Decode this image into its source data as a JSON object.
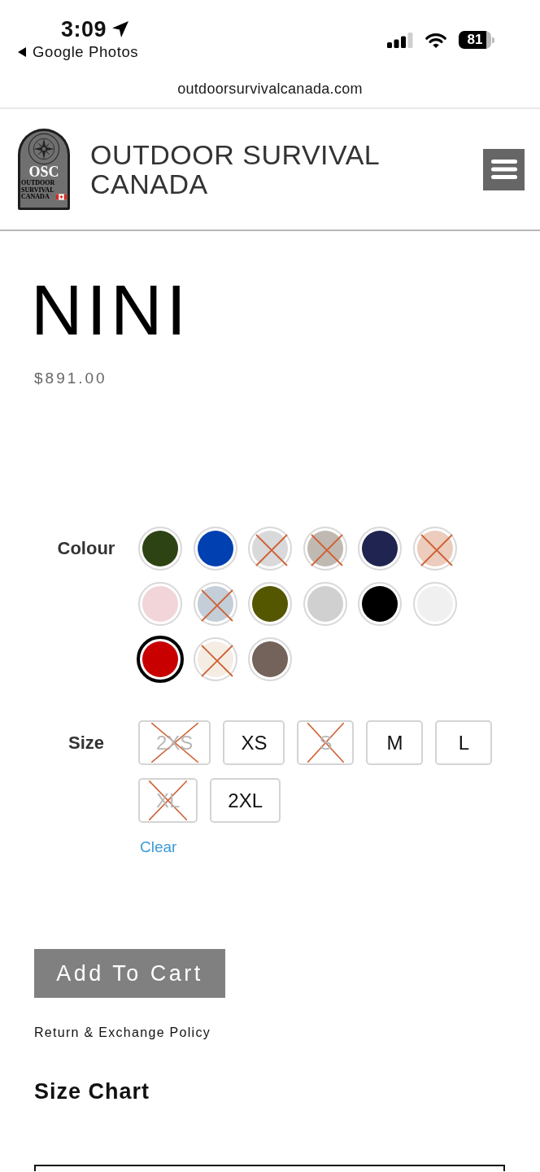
{
  "status_bar": {
    "time": "3:09",
    "back_label": "Google Photos",
    "battery": "81"
  },
  "address_bar": {
    "url": "outdoorsurvivalcanada.com"
  },
  "header": {
    "logo": {
      "monogram": "OSC",
      "tagline": "OUTDOOR SURVIVAL CANADA"
    },
    "site_title": "OUTDOOR SURVIVAL CANADA"
  },
  "product": {
    "name": "NINI",
    "price": "$891.00"
  },
  "colour": {
    "label": "Colour",
    "swatches": [
      {
        "color": "#2d4314",
        "available": true,
        "selected": false
      },
      {
        "color": "#0040b0",
        "available": true,
        "selected": false
      },
      {
        "color": "#d9d9dc",
        "available": false,
        "selected": false
      },
      {
        "color": "#c0b9b2",
        "available": false,
        "selected": false
      },
      {
        "color": "#1f2550",
        "available": true,
        "selected": false
      },
      {
        "color": "#ecccbc",
        "available": false,
        "selected": false
      },
      {
        "color": "#f2d5d8",
        "available": true,
        "selected": false
      },
      {
        "color": "#c3ced8",
        "available": false,
        "selected": false
      },
      {
        "color": "#545700",
        "available": true,
        "selected": false
      },
      {
        "color": "#d0d0d0",
        "available": true,
        "selected": false
      },
      {
        "color": "#000000",
        "available": true,
        "selected": false
      },
      {
        "color": "#f0f0f0",
        "available": true,
        "selected": false
      },
      {
        "color": "#c80000",
        "available": true,
        "selected": true
      },
      {
        "color": "#f5ede4",
        "available": false,
        "selected": false
      },
      {
        "color": "#74635a",
        "available": true,
        "selected": false
      }
    ]
  },
  "size": {
    "label": "Size",
    "options": [
      {
        "label": "2XS",
        "available": false,
        "selected": false
      },
      {
        "label": "XS",
        "available": true,
        "selected": false
      },
      {
        "label": "S",
        "available": false,
        "selected": false
      },
      {
        "label": "M",
        "available": true,
        "selected": false
      },
      {
        "label": "L",
        "available": true,
        "selected": false
      },
      {
        "label": "XL",
        "available": false,
        "selected": false
      },
      {
        "label": "2XL",
        "available": true,
        "selected": false
      }
    ],
    "clear_label": "Clear"
  },
  "add_to_cart": "Add To Cart",
  "policy_link": "Return & Exchange Policy",
  "size_chart": {
    "title": "Size Chart"
  }
}
